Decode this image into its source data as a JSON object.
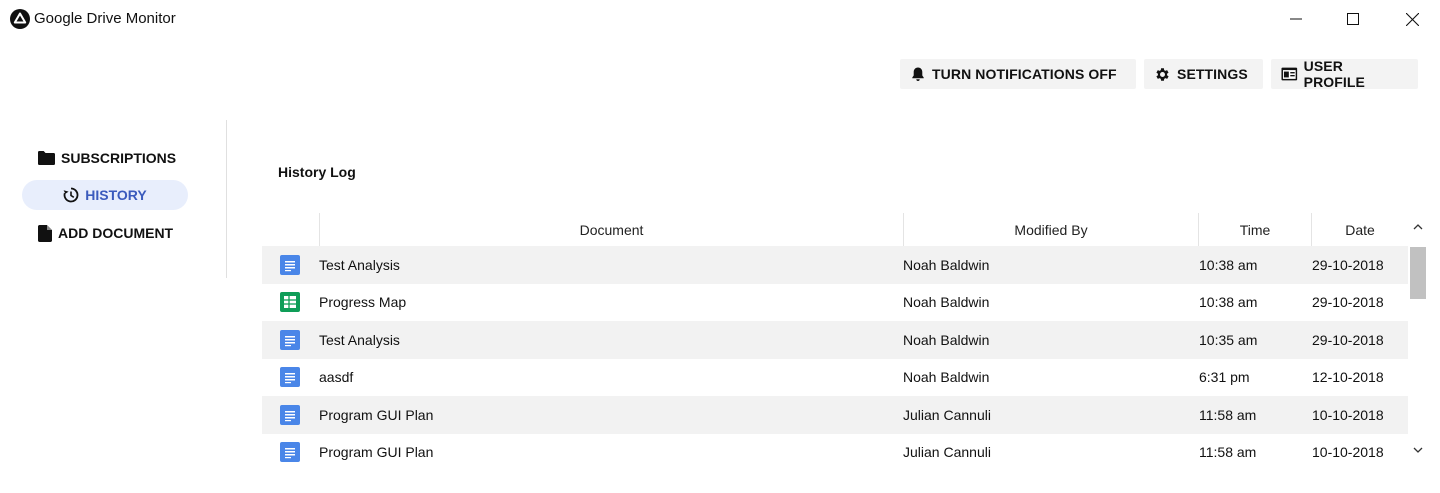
{
  "window": {
    "title": "Google Drive Monitor",
    "app_icon": "drive-logo-icon",
    "controls": [
      "minimize-icon",
      "maximize-icon",
      "close-icon"
    ]
  },
  "toolbar": {
    "notifications_label": "TURN NOTIFICATIONS OFF",
    "notifications_icon": "bell-icon",
    "settings_label": "SETTINGS",
    "settings_icon": "gear-icon",
    "profile_label": "USER PROFILE",
    "profile_icon": "profile-card-icon"
  },
  "sidebar": {
    "items": [
      {
        "label": "SUBSCRIPTIONS",
        "icon": "folder-icon",
        "active": false
      },
      {
        "label": "HISTORY",
        "icon": "history-icon",
        "active": true
      },
      {
        "label": "ADD DOCUMENT",
        "icon": "document-icon",
        "active": false
      }
    ],
    "active_color": "#3b5bbd",
    "active_background": "#e8eefc"
  },
  "main": {
    "title": "History Log",
    "table": {
      "columns": [
        "Document",
        "Modified By",
        "Time",
        "Date"
      ],
      "rows": [
        {
          "type": "doc",
          "document": "Test Analysis",
          "modified_by": "Noah Baldwin",
          "time": "10:38 am",
          "date": "29-10-2018"
        },
        {
          "type": "sheet",
          "document": "Progress Map",
          "modified_by": "Noah Baldwin",
          "time": "10:38 am",
          "date": "29-10-2018"
        },
        {
          "type": "doc",
          "document": "Test Analysis",
          "modified_by": "Noah Baldwin",
          "time": "10:35 am",
          "date": "29-10-2018"
        },
        {
          "type": "doc",
          "document": "aasdf",
          "modified_by": "Noah Baldwin",
          "time": "6:31 pm",
          "date": "12-10-2018"
        },
        {
          "type": "doc",
          "document": "Program GUI Plan",
          "modified_by": "Julian Cannuli",
          "time": "11:58 am",
          "date": "10-10-2018"
        },
        {
          "type": "doc",
          "document": "Program GUI Plan",
          "modified_by": "Julian Cannuli",
          "time": "11:58 am",
          "date": "10-10-2018"
        }
      ]
    }
  },
  "colors": {
    "doc_icon": "#4a86e8",
    "sheet_icon": "#0f9d58",
    "row_alt": "#f2f2f2",
    "button_bg": "#f3f3f3"
  }
}
